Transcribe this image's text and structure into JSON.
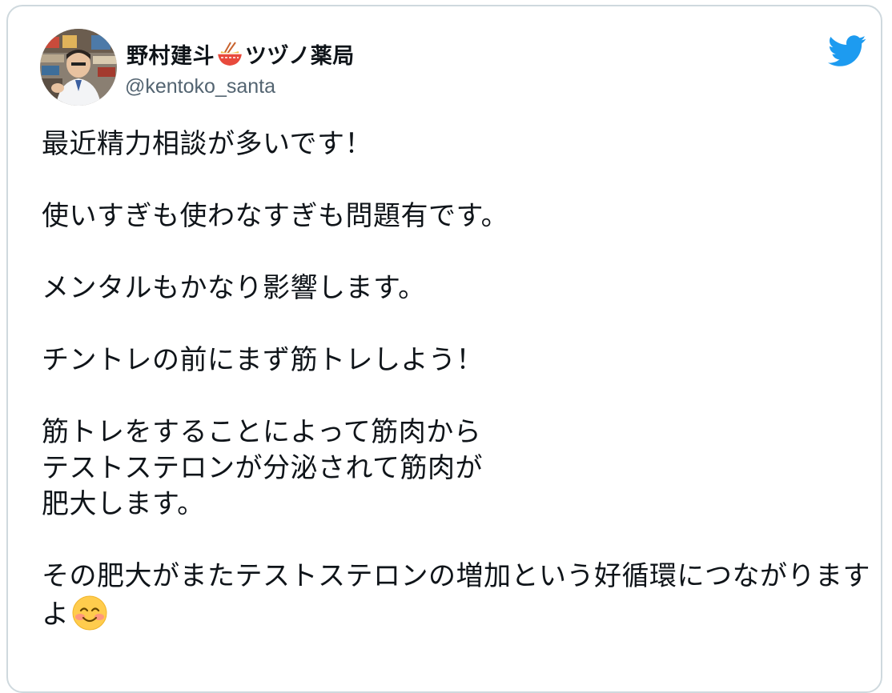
{
  "tweet": {
    "author": {
      "display_name_part1": "野村建斗",
      "display_name_emoji": "ramen-bowl-emoji",
      "display_name_part2": "ツヅノ薬局",
      "handle": "@kentoko_santa",
      "avatar": "pharmacist-photo"
    },
    "platform_icon": "twitter-bird-icon",
    "platform_color": "#1d9bf0",
    "text_blocks": {
      "p1": "最近精力相談が多いです！",
      "p2": "使いすぎも使わなすぎも問題有です。",
      "p3": "メンタルもかなり影響します。",
      "p4": "チントレの前にまず筋トレしよう！",
      "p5_l1": "筋トレをすることによって筋肉から",
      "p5_l2": "テストステロンが分泌されて筋肉が",
      "p5_l3": "肥大します。",
      "p6": "その肥大がまたテストステロンの増加という好循環につながりますよ",
      "p6_emoji": "smiling-face-with-blush-emoji"
    }
  }
}
